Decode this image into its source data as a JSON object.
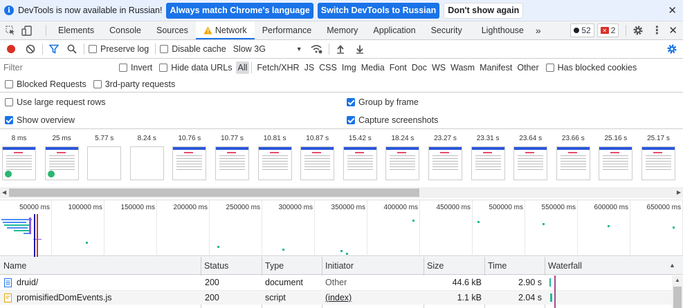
{
  "infobar": {
    "message": "DevTools is now available in Russian!",
    "match_button": "Always match Chrome's language",
    "switch_button": "Switch DevTools to Russian",
    "dismiss_button": "Don't show again"
  },
  "tabs": [
    "Elements",
    "Console",
    "Sources",
    "Network",
    "Performance",
    "Memory",
    "Application",
    "Security",
    "Lighthouse"
  ],
  "active_tab": "Network",
  "badges": {
    "messages": "52",
    "errors": "2"
  },
  "toolbar": {
    "preserve_log": "Preserve log",
    "disable_cache": "Disable cache",
    "throttle": "Slow 3G",
    "preserve_checked": false,
    "disable_cache_checked": false
  },
  "filter": {
    "placeholder": "Filter",
    "invert": "Invert",
    "hide_data_urls": "Hide data URLs",
    "types": [
      "All",
      "Fetch/XHR",
      "JS",
      "CSS",
      "Img",
      "Media",
      "Font",
      "Doc",
      "WS",
      "Wasm",
      "Manifest",
      "Other"
    ],
    "active_type": "All",
    "blocked_cookies": "Has blocked cookies",
    "blocked_requests": "Blocked Requests",
    "third_party": "3rd-party requests"
  },
  "settings": {
    "large_rows": "Use large request rows",
    "group_by_frame": "Group by frame",
    "show_overview": "Show overview",
    "capture_screenshots": "Capture screenshots",
    "large_rows_checked": false,
    "group_by_frame_checked": true,
    "show_overview_checked": true,
    "capture_screenshots_checked": true
  },
  "screenshot_times": [
    "8 ms",
    "25 ms",
    "5.77 s",
    "8.24 s",
    "10.76 s",
    "10.77 s",
    "10.81 s",
    "10.87 s",
    "15.42 s",
    "18.24 s",
    "23.27 s",
    "23.31 s",
    "23.64 s",
    "23.66 s",
    "25.16 s",
    "25.17 s"
  ],
  "timeline_ticks": [
    "50000 ms",
    "100000 ms",
    "150000 ms",
    "200000 ms",
    "250000 ms",
    "300000 ms",
    "350000 ms",
    "400000 ms",
    "450000 ms",
    "500000 ms",
    "550000 ms",
    "600000 ms",
    "650000 ms"
  ],
  "table": {
    "columns": [
      "Name",
      "Status",
      "Type",
      "Initiator",
      "Size",
      "Time",
      "Waterfall"
    ],
    "rows": [
      {
        "name": "druid/",
        "status": "200",
        "type": "document",
        "initiator": "Other",
        "size": "44.6 kB",
        "time": "2.90 s",
        "icon": "document-icon"
      },
      {
        "name": "promisifiedDomEvents.js",
        "status": "200",
        "type": "script",
        "initiator": "(index)",
        "size": "1.1 kB",
        "time": "2.04 s",
        "icon": "script-icon"
      }
    ]
  },
  "colors": {
    "accent": "#1a73e8",
    "record": "#d93025",
    "waterfall": "#1fb998"
  }
}
